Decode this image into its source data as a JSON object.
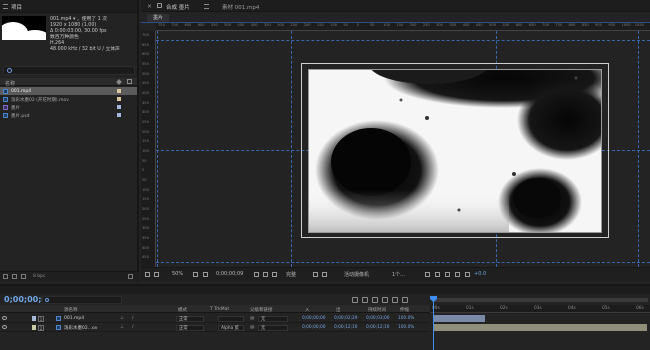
{
  "project": {
    "tab": "项目",
    "selected_file": "001.mp4",
    "used_times": "，使用了 1 次",
    "meta": [
      "1920 x 1080 (1.00)",
      "Δ 0:00:03:00, 30.00 fps",
      "数百万种颜色",
      "H.264",
      "48.000 kHz / 32 bit U / 立体声"
    ],
    "search_placeholder": "",
    "column_name": "名称",
    "files": [
      {
        "name": "001.mp4",
        "selected": true,
        "kind": "footage",
        "color": "#d8c9a3"
      },
      {
        "name": "泼彩水墨02 (开花时期).mov",
        "selected": false,
        "kind": "footage",
        "color": "#d8c9a3"
      },
      {
        "name": "墨片",
        "selected": false,
        "kind": "comp",
        "color": "#a6b8d9"
      },
      {
        "name": "墨片.psd",
        "selected": false,
        "kind": "footage",
        "color": "#a6b8d9"
      }
    ],
    "bpc": "8 bpc"
  },
  "comp": {
    "tab_label": "合成 墨片",
    "footage_tab_label": "素材 001.mp4",
    "subtab": "墨片",
    "ruler_top": [
      "750",
      "700",
      "650",
      "600",
      "550",
      "500",
      "450",
      "400",
      "350",
      "300",
      "250",
      "200",
      "150",
      "100",
      "50",
      "0",
      "50",
      "100",
      "150",
      "200",
      "250",
      "300",
      "350",
      "400",
      "450",
      "500",
      "550",
      "600",
      "650",
      "700",
      "750",
      "800",
      "850",
      "900",
      "950",
      "1000",
      "1050"
    ],
    "ruler_left": [
      "700",
      "650",
      "600",
      "550",
      "500",
      "450",
      "400",
      "350",
      "300",
      "250",
      "200",
      "150",
      "100",
      "50",
      "0",
      "50",
      "100",
      "150",
      "200",
      "250",
      "300",
      "350",
      "400",
      "450"
    ],
    "zoom": "50%",
    "time": "0;00;00;09",
    "resolution": "完整",
    "camera": "活动摄像机",
    "views": "1个...",
    "exposure": "+0.0"
  },
  "timeline": {
    "timecode": "0;00;00;09",
    "columns": {
      "source_name": "源名称",
      "mode": "模式",
      "trkmat": "T TrkMat",
      "parent": "父级和链接",
      "in": "入",
      "out": "出",
      "duration": "持续时间",
      "stretch": "伸缩"
    },
    "ruler": [
      "00s",
      "01s",
      "02s",
      "03s",
      "04s",
      "05s",
      "06s"
    ],
    "layers": [
      {
        "num": "1",
        "name": "001.mp4",
        "mode": "正常",
        "trkmat": "",
        "parent": "无",
        "in": "0;00;00;00",
        "out": "0;00;02;29",
        "duration": "0;00;03;00",
        "stretch": "100.0%",
        "color": "#a6b8d9"
      },
      {
        "num": "2",
        "name": "泼彩水墨02...ov",
        "mode": "正常",
        "trkmat": "Alpha 反",
        "parent": "无",
        "in": "0;00;00;00",
        "out": "0;00;12;16",
        "duration": "0;00;12;16",
        "stretch": "100.0%",
        "color": "#c9c9a6"
      }
    ]
  }
}
